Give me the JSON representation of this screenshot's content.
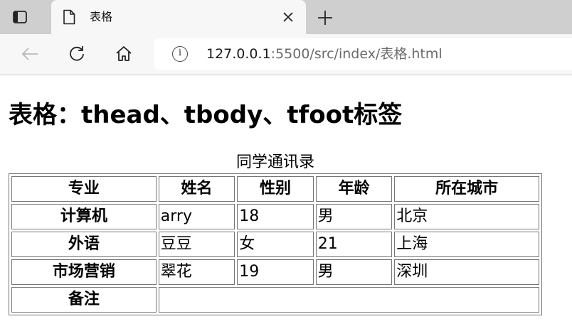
{
  "browser": {
    "tab_title": "表格",
    "url_host": "127.0.0.1",
    "url_rest": ":5500/src/index/表格.html"
  },
  "page": {
    "heading": "表格：thead、tbody、tfoot标签",
    "caption": "同学通讯录",
    "columns": [
      "专业",
      "姓名",
      "性别",
      "年龄",
      "所在城市"
    ],
    "rows": [
      {
        "major": "计算机",
        "name": "arry",
        "gender": "18",
        "age": "男",
        "city": "北京"
      },
      {
        "major": "外语",
        "name": "豆豆",
        "gender": "女",
        "age": "21",
        "city": "上海"
      },
      {
        "major": "市场营销",
        "name": "翠花",
        "gender": "19",
        "age": "男",
        "city": "深圳"
      }
    ],
    "footer": {
      "label": "备注",
      "value": ""
    }
  }
}
